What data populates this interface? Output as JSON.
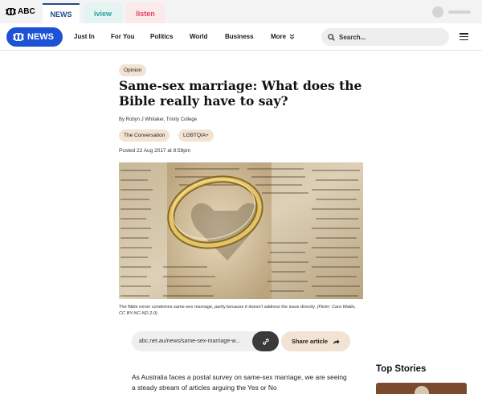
{
  "network_bar": {
    "logo_text": "ABC",
    "tabs": [
      {
        "label": "NEWS",
        "active": true
      },
      {
        "label": "iview",
        "active": false
      },
      {
        "label": "listen",
        "active": false
      }
    ]
  },
  "news_header": {
    "logo_text": "NEWS",
    "nav": [
      "Just In",
      "For You",
      "Politics",
      "World",
      "Business",
      "More"
    ],
    "search_placeholder": "Search..."
  },
  "article": {
    "category": "Opinion",
    "headline": "Same-sex marriage: What does the Bible really have to say?",
    "byline": "By Robyn J Whitaker, Trinity College",
    "tags": [
      "The Conversation",
      "LGBTQIA+"
    ],
    "posted": "Posted 22 Aug 2017 at 8:59pm",
    "image": {
      "caption": "The Bible never condemns same-sex marriage, partly because it doesn't address the issue directly.",
      "credit": "(Flickr: Caro Wallis, CC BY-NC-ND 2.0)"
    },
    "share": {
      "url": "abc.net.au/news/same-sex-marriage-w...",
      "share_label": "Share article"
    },
    "body_start": "As Australia faces a postal survey on same-sex marriage, we are seeing a steady stream of articles arguing the Yes or No"
  },
  "sidebar": {
    "top_stories_title": "Top Stories"
  },
  "colors": {
    "brand_blue": "#1d52d6",
    "tag_bg": "#f2e3d3",
    "iview_teal": "#2aa39a",
    "listen_pink": "#e0455c"
  }
}
